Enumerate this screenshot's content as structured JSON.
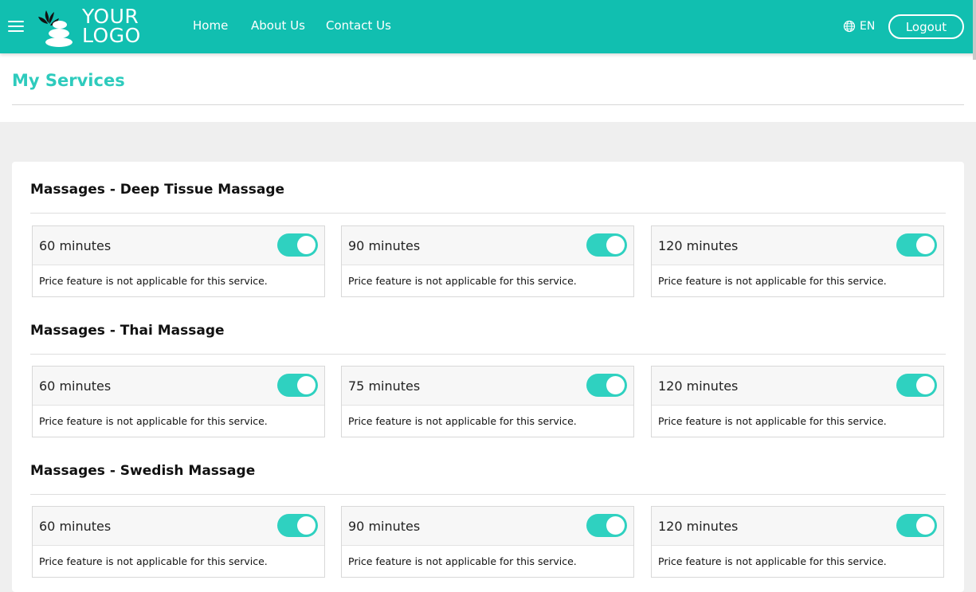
{
  "header": {
    "logo_line1": "YOUR",
    "logo_line2": "LOGO",
    "nav": [
      {
        "label": "Home"
      },
      {
        "label": "About Us"
      },
      {
        "label": "Contact Us"
      }
    ],
    "language": "EN",
    "logout_label": "Logout",
    "brand_color": "#11bfb0"
  },
  "page": {
    "title": "My Services"
  },
  "sections": [
    {
      "title": "Massages - Deep Tissue Massage",
      "cards": [
        {
          "duration": "60 minutes",
          "enabled": true,
          "note": "Price feature is not applicable for this service."
        },
        {
          "duration": "90 minutes",
          "enabled": true,
          "note": "Price feature is not applicable for this service."
        },
        {
          "duration": "120 minutes",
          "enabled": true,
          "note": "Price feature is not applicable for this service."
        }
      ]
    },
    {
      "title": "Massages - Thai Massage",
      "cards": [
        {
          "duration": "60 minutes",
          "enabled": true,
          "note": "Price feature is not applicable for this service."
        },
        {
          "duration": "75 minutes",
          "enabled": true,
          "note": "Price feature is not applicable for this service."
        },
        {
          "duration": "120 minutes",
          "enabled": true,
          "note": "Price feature is not applicable for this service."
        }
      ]
    },
    {
      "title": "Massages - Swedish Massage",
      "cards": [
        {
          "duration": "60 minutes",
          "enabled": true,
          "note": "Price feature is not applicable for this service."
        },
        {
          "duration": "90 minutes",
          "enabled": true,
          "note": "Price feature is not applicable for this service."
        },
        {
          "duration": "120 minutes",
          "enabled": true,
          "note": "Price feature is not applicable for this service."
        }
      ]
    }
  ]
}
